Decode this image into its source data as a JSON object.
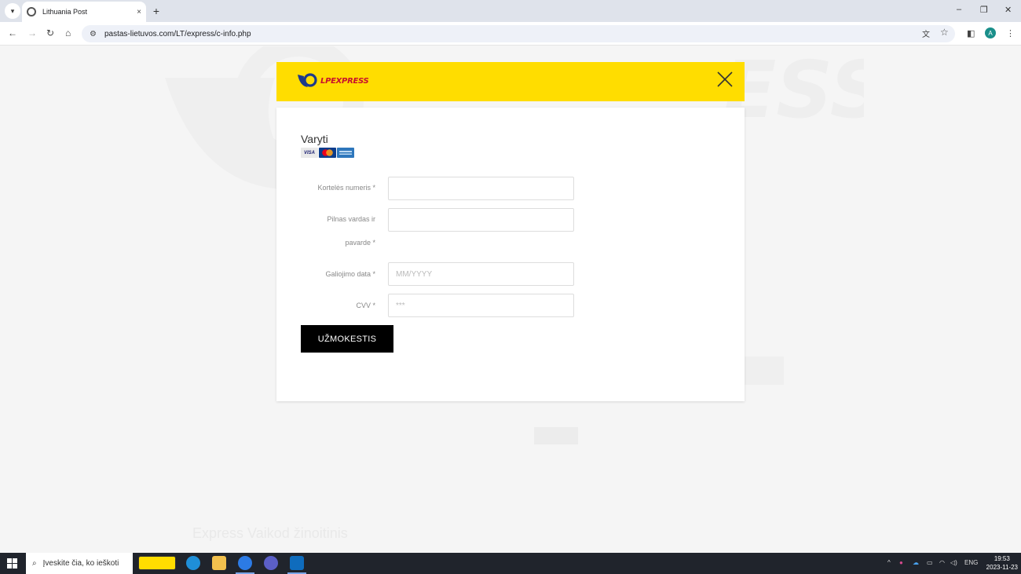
{
  "browser": {
    "tab_title": "Lithuania Post",
    "tab_close": "×",
    "new_tab": "+",
    "url": "pastas-lietuvos.com/LT/express/c-info.php",
    "window_controls": [
      "–",
      "❐",
      "✕"
    ]
  },
  "modal": {
    "logo_text": "LPEXPRESS",
    "close_icon": "close-icon",
    "colors": {
      "header": "#ffdd00",
      "button": "#000000",
      "logo_red": "#c8102e"
    }
  },
  "form": {
    "title": "Varyti",
    "cards": [
      "VISA",
      "Mastercard",
      "American Express"
    ],
    "fields": [
      {
        "label": "Kortelės numeris *",
        "placeholder": ""
      },
      {
        "label": "Pilnas vardas ir pavarde *",
        "label_line1": "Pilnas vardas ir",
        "label_line2": "pavarde *",
        "placeholder": ""
      },
      {
        "label": "Galiojimo data *",
        "placeholder": "MM/YYYY"
      },
      {
        "label": "CVV *",
        "placeholder": "***"
      }
    ],
    "submit_label": "UŽMOKESTIS"
  },
  "background": {
    "heading_hint": "Express Vaikod žinoitinis"
  },
  "taskbar": {
    "search_placeholder": "Įveskite čia, ko ieškoti",
    "language": "ENG",
    "time": "19:53",
    "date": "2023-11-23"
  }
}
